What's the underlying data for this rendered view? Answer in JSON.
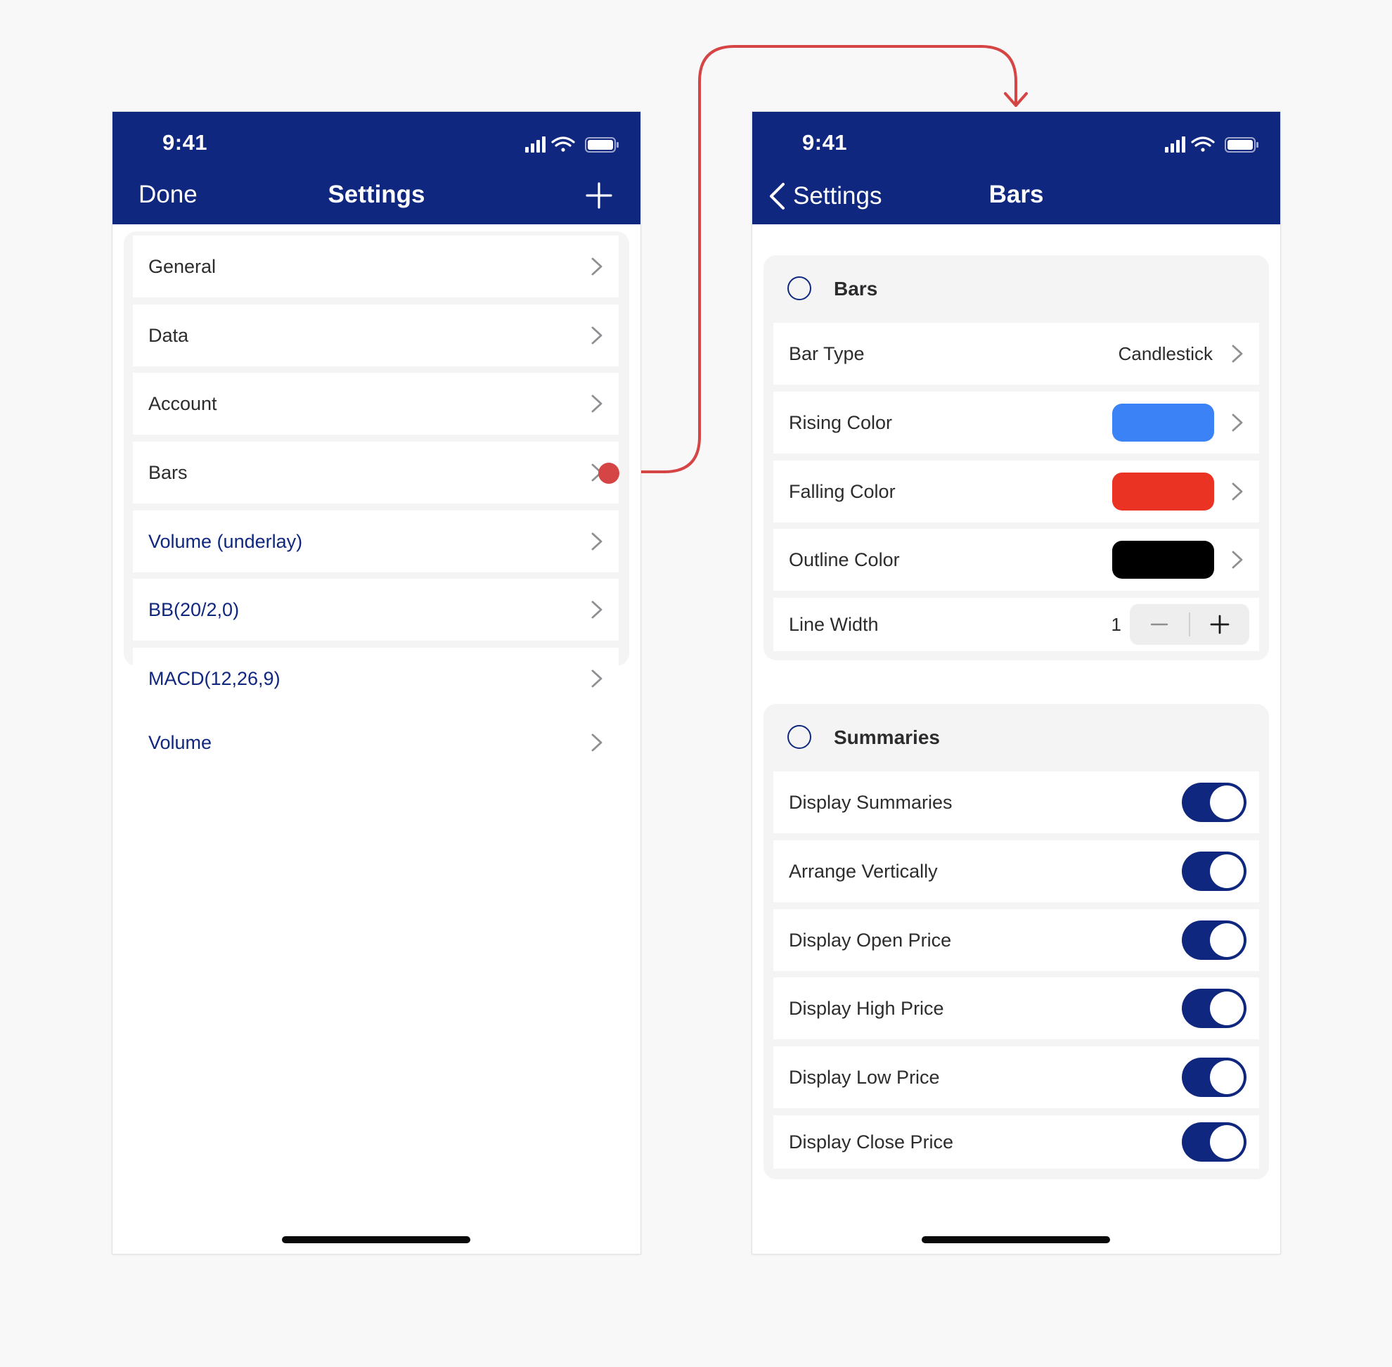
{
  "colors": {
    "header_bg": "#10277f",
    "accent_blue": "#10277f",
    "rising": "#3b82f6",
    "falling": "#ea3323",
    "outline": "#000000",
    "connector": "#d64545"
  },
  "left_screen": {
    "status": {
      "time": "9:41",
      "icons": [
        "signal-icon",
        "wifi-icon",
        "battery-icon"
      ]
    },
    "nav": {
      "left_label": "Done",
      "title": "Settings",
      "right_icon": "plus-icon"
    },
    "items": [
      {
        "label": "General",
        "style": "default"
      },
      {
        "label": "Data",
        "style": "default"
      },
      {
        "label": "Account",
        "style": "default"
      },
      {
        "label": "Bars",
        "style": "default",
        "linked": true
      },
      {
        "label": "Volume (underlay)",
        "style": "blue"
      },
      {
        "label": "BB(20/2,0)",
        "style": "blue"
      },
      {
        "label": "MACD(12,26,9)",
        "style": "blue"
      },
      {
        "label": "Volume",
        "style": "blue"
      }
    ]
  },
  "right_screen": {
    "status": {
      "time": "9:41",
      "icons": [
        "signal-icon",
        "wifi-icon",
        "battery-icon"
      ]
    },
    "nav": {
      "back_label": "Settings",
      "title": "Bars"
    },
    "bars_section": {
      "title": "Bars",
      "rows": {
        "bar_type": {
          "label": "Bar Type",
          "value": "Candlestick"
        },
        "rising_color": {
          "label": "Rising Color",
          "color": "#3b82f6"
        },
        "falling_color": {
          "label": "Falling Color",
          "color": "#ea3323"
        },
        "outline_color": {
          "label": "Outline Color",
          "color": "#000000"
        },
        "line_width": {
          "label": "Line Width",
          "value": "1"
        }
      }
    },
    "summaries_section": {
      "title": "Summaries",
      "toggles": [
        {
          "label": "Display Summaries",
          "on": true
        },
        {
          "label": "Arrange Vertically",
          "on": true
        },
        {
          "label": "Display Open Price",
          "on": true
        },
        {
          "label": "Display High Price",
          "on": true
        },
        {
          "label": "Display Low Price",
          "on": true
        },
        {
          "label": "Display Close Price",
          "on": true
        }
      ]
    }
  }
}
